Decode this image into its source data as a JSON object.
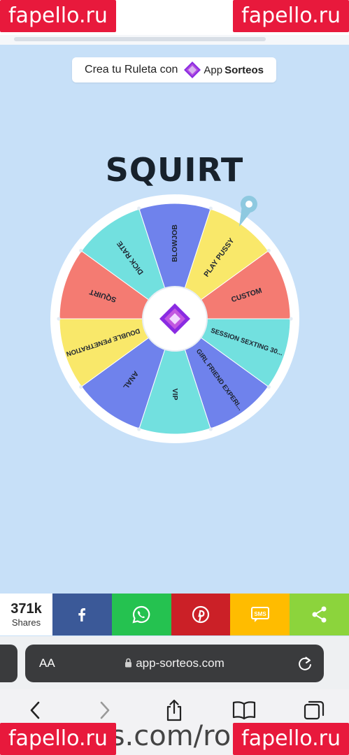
{
  "watermark": {
    "text": "fapello.ru"
  },
  "promo": {
    "text": "Crea tu Ruleta con",
    "brand_prefix": "App",
    "brand_suffix": "Sorteos"
  },
  "wheel": {
    "title": "SQUIRT",
    "segments": [
      {
        "label": "SQUIRT",
        "color": "#f47b72"
      },
      {
        "label": "DICK RATE",
        "color": "#72e0df"
      },
      {
        "label": "BLOWJOB",
        "color": "#6f82ec"
      },
      {
        "label": "PLAY PUSSY",
        "color": "#f9e86a"
      },
      {
        "label": "CUSTOM",
        "color": "#f47b72"
      },
      {
        "label": "SESSION SEXTING 30...",
        "color": "#72e0df"
      },
      {
        "label": "GIRL FRIEND EXPERI...",
        "color": "#6f82ec"
      },
      {
        "label": "VIP",
        "color": "#72e0df"
      },
      {
        "label": "ANAL",
        "color": "#6f82ec"
      },
      {
        "label": "DOUBLE PENETRATION",
        "color": "#f9e86a"
      }
    ]
  },
  "share": {
    "count": "371k",
    "count_label": "Shares",
    "buttons": [
      {
        "name": "facebook",
        "color": "#3b5998"
      },
      {
        "name": "whatsapp",
        "color": "#25c250"
      },
      {
        "name": "pinterest",
        "color": "#cb2027"
      },
      {
        "name": "sms",
        "color": "#ffbc00",
        "label": "SMS"
      },
      {
        "name": "share",
        "color": "#8cd43c"
      }
    ]
  },
  "browser": {
    "aa": "AA",
    "url": "app-sorteos.com"
  },
  "footer_text": "...s.com/rol..."
}
